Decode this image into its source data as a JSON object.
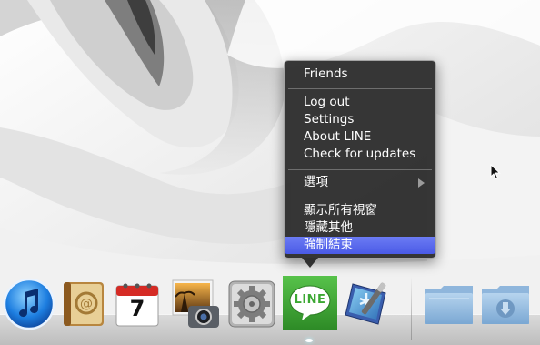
{
  "menu": {
    "items": [
      {
        "label": "Friends"
      },
      {
        "label": "Log out"
      },
      {
        "label": "Settings"
      },
      {
        "label": "About LINE"
      },
      {
        "label": "Check for updates"
      },
      {
        "label": "選項"
      },
      {
        "label": "顯示所有視窗"
      },
      {
        "label": "隱藏其他"
      },
      {
        "label": "強制結束"
      }
    ],
    "highlighted_item": "強制結束"
  },
  "dock": {
    "calendar_day": "7",
    "line_label": "LINE",
    "apps": [
      {
        "icon": "itunes-icon"
      },
      {
        "icon": "address-book-icon"
      },
      {
        "icon": "ical-icon"
      },
      {
        "icon": "iphoto-icon"
      },
      {
        "icon": "system-preferences-icon"
      },
      {
        "icon": "line-icon"
      },
      {
        "icon": "xcode-icon"
      },
      {
        "icon": "folder-icon"
      },
      {
        "icon": "folder-icon"
      }
    ]
  },
  "colors": {
    "menu_background": "#262626",
    "highlight": "#5869ec",
    "line_green": "#3ca833"
  }
}
